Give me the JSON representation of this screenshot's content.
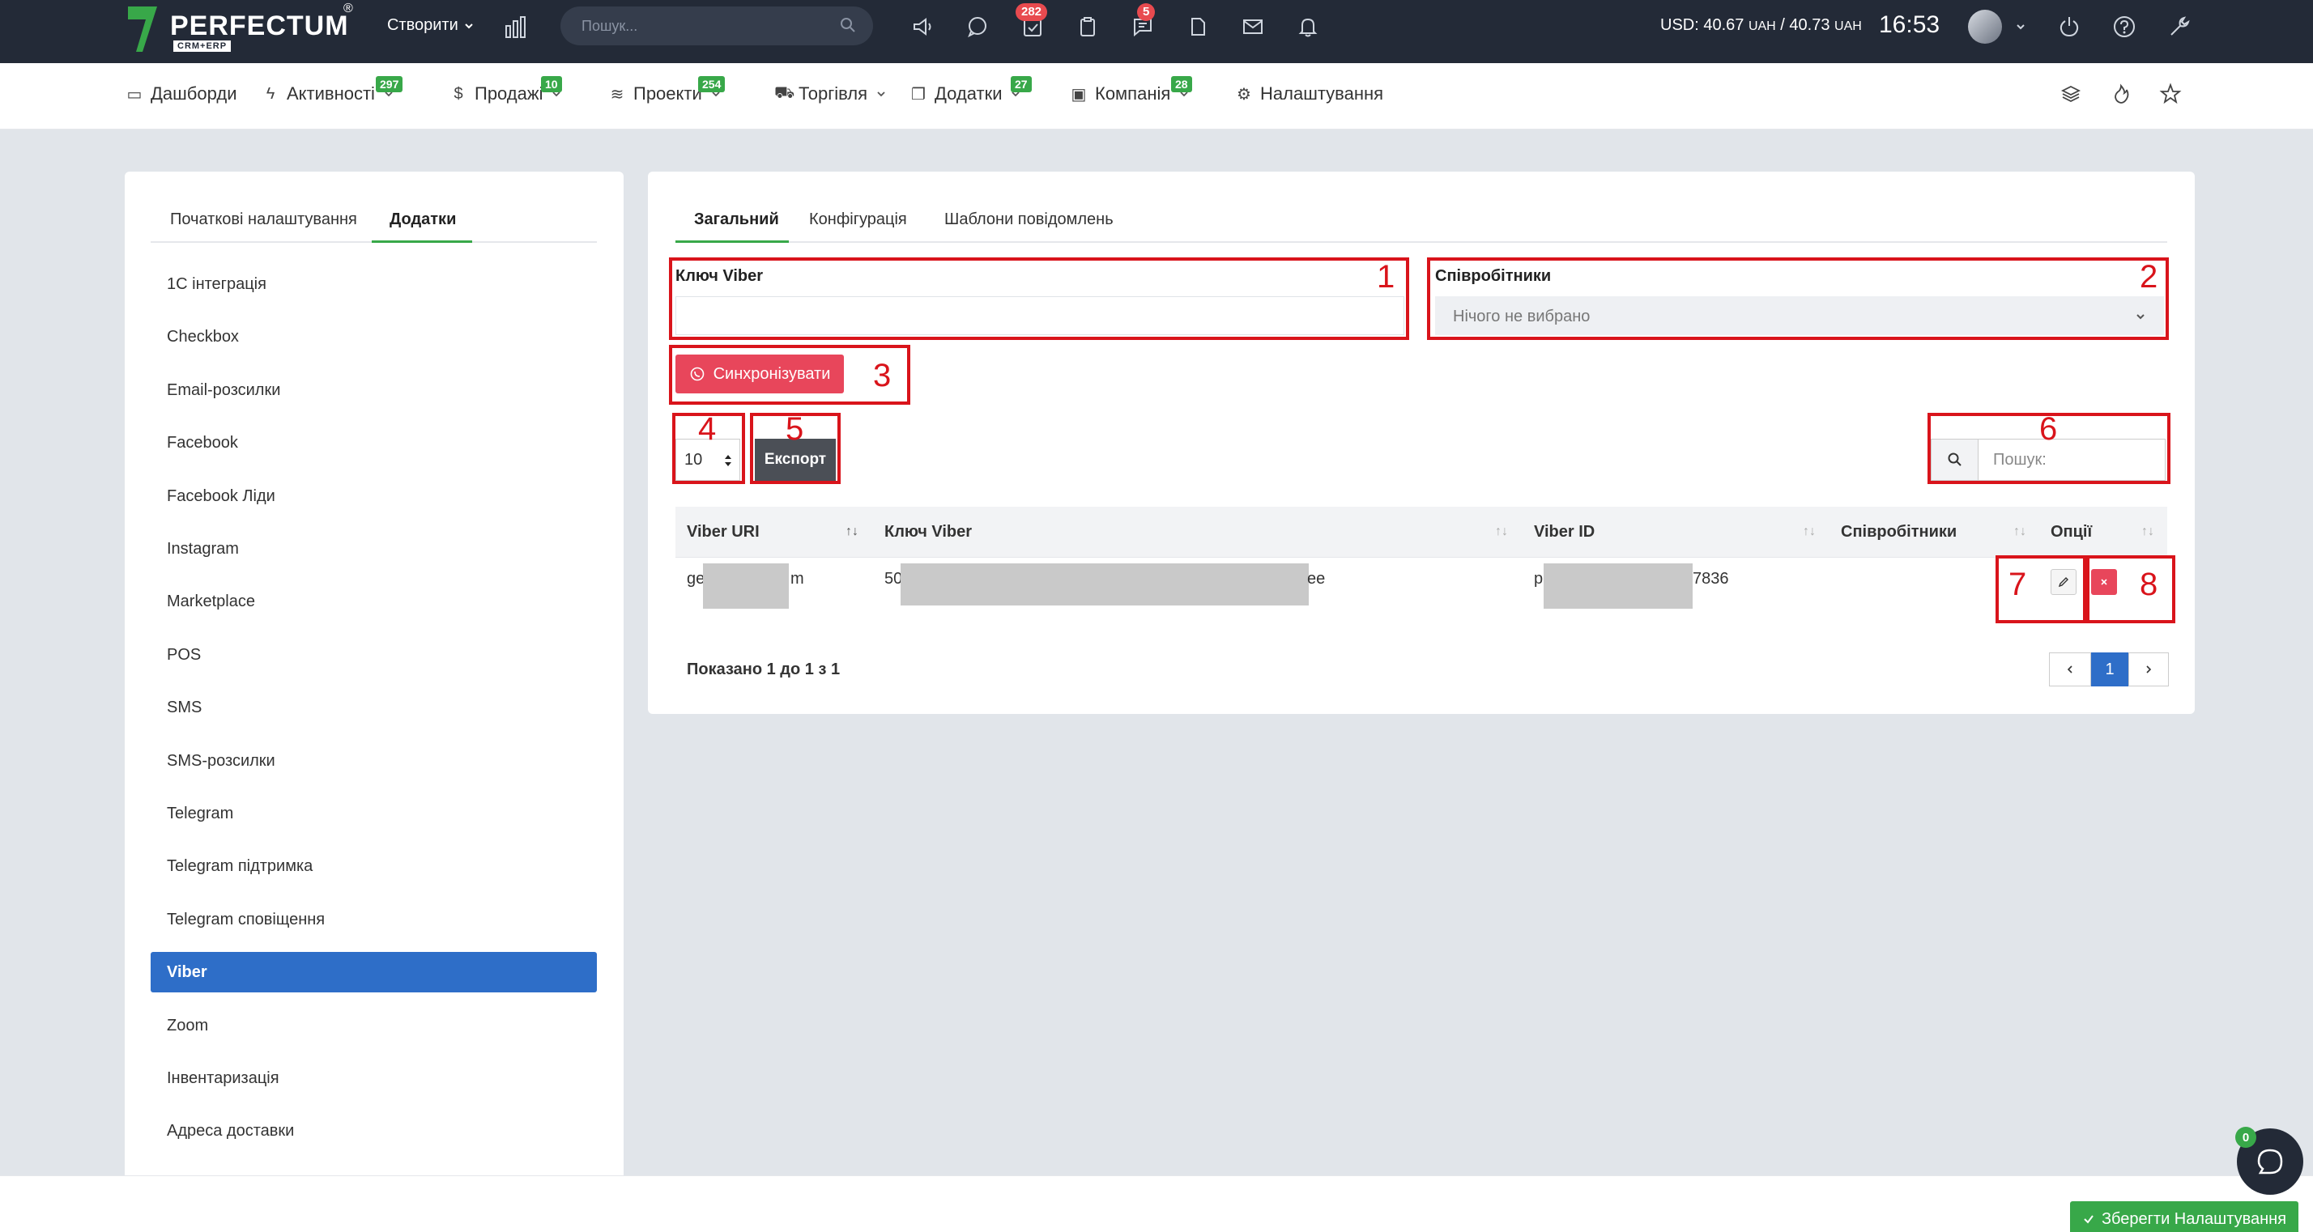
{
  "topbar": {
    "logo_text": "PERFECTUM",
    "logo_sub": "CRM+ERP",
    "logo_reg": "®",
    "create_label": "Створити",
    "search_placeholder": "Пошук...",
    "tasks_badge": "282",
    "messages_badge": "5",
    "currency_usd": "USD: 40.67",
    "currency_uah1": "UAH",
    "currency_sep": " / 40.73 ",
    "currency_uah2": "UAH",
    "clock": "16:53"
  },
  "nav": {
    "items": [
      {
        "label": "Дашборди",
        "badge": ""
      },
      {
        "label": "Активності",
        "badge": "297"
      },
      {
        "label": "Продажі",
        "badge": "10"
      },
      {
        "label": "Проекти",
        "badge": "254"
      },
      {
        "label": "Торгівля",
        "badge": ""
      },
      {
        "label": "Додатки",
        "badge": "27"
      },
      {
        "label": "Компанія",
        "badge": "28"
      },
      {
        "label": "Налаштування",
        "badge": ""
      }
    ]
  },
  "sidebar": {
    "tabs": [
      "Початкові налаштування",
      "Додатки"
    ],
    "items": [
      "1С інтеграція",
      "Checkbox",
      "Email-розсилки",
      "Facebook",
      "Facebook Ліди",
      "Instagram",
      "Marketplace",
      "POS",
      "SMS",
      "SMS-розсилки",
      "Telegram",
      "Telegram підтримка",
      "Telegram сповіщення",
      "Viber",
      "Zoom",
      "Інвентаризація",
      "Адреса доставки"
    ],
    "active_index": 13
  },
  "main": {
    "tabs": [
      "Загальний",
      "Конфігурація",
      "Шаблони повідомлень"
    ],
    "viber_key_label": "Ключ Viber",
    "viber_key_value": "",
    "employees_label": "Співробітники",
    "employees_placeholder": "Нічого не вибрано",
    "sync_label": "Синхронізувати",
    "page_length": "10",
    "export_label": "Експорт",
    "search_placeholder": "Пошук:",
    "columns": [
      "Viber URI",
      "Ключ Viber",
      "Viber ID",
      "Співробітники",
      "Опції"
    ],
    "row": {
      "uri_start": "ge",
      "uri_end": "m",
      "key_start": "50",
      "key_end": "ee",
      "id_start": "p",
      "id_end": "7836",
      "employees": ""
    },
    "info": "Показано 1 до 1 з 1",
    "current_page": "1",
    "annotations": [
      "1",
      "2",
      "3",
      "4",
      "5",
      "6",
      "7",
      "8"
    ]
  },
  "footer": {
    "save_label": "Зберегти Налаштування",
    "chat_badge": "0"
  },
  "colors": {
    "topbar": "#232a37",
    "accent_green": "#38a849",
    "accent_red": "#e8465b",
    "active_blue": "#2e6ec8",
    "annotation_red": "#d9141b"
  }
}
